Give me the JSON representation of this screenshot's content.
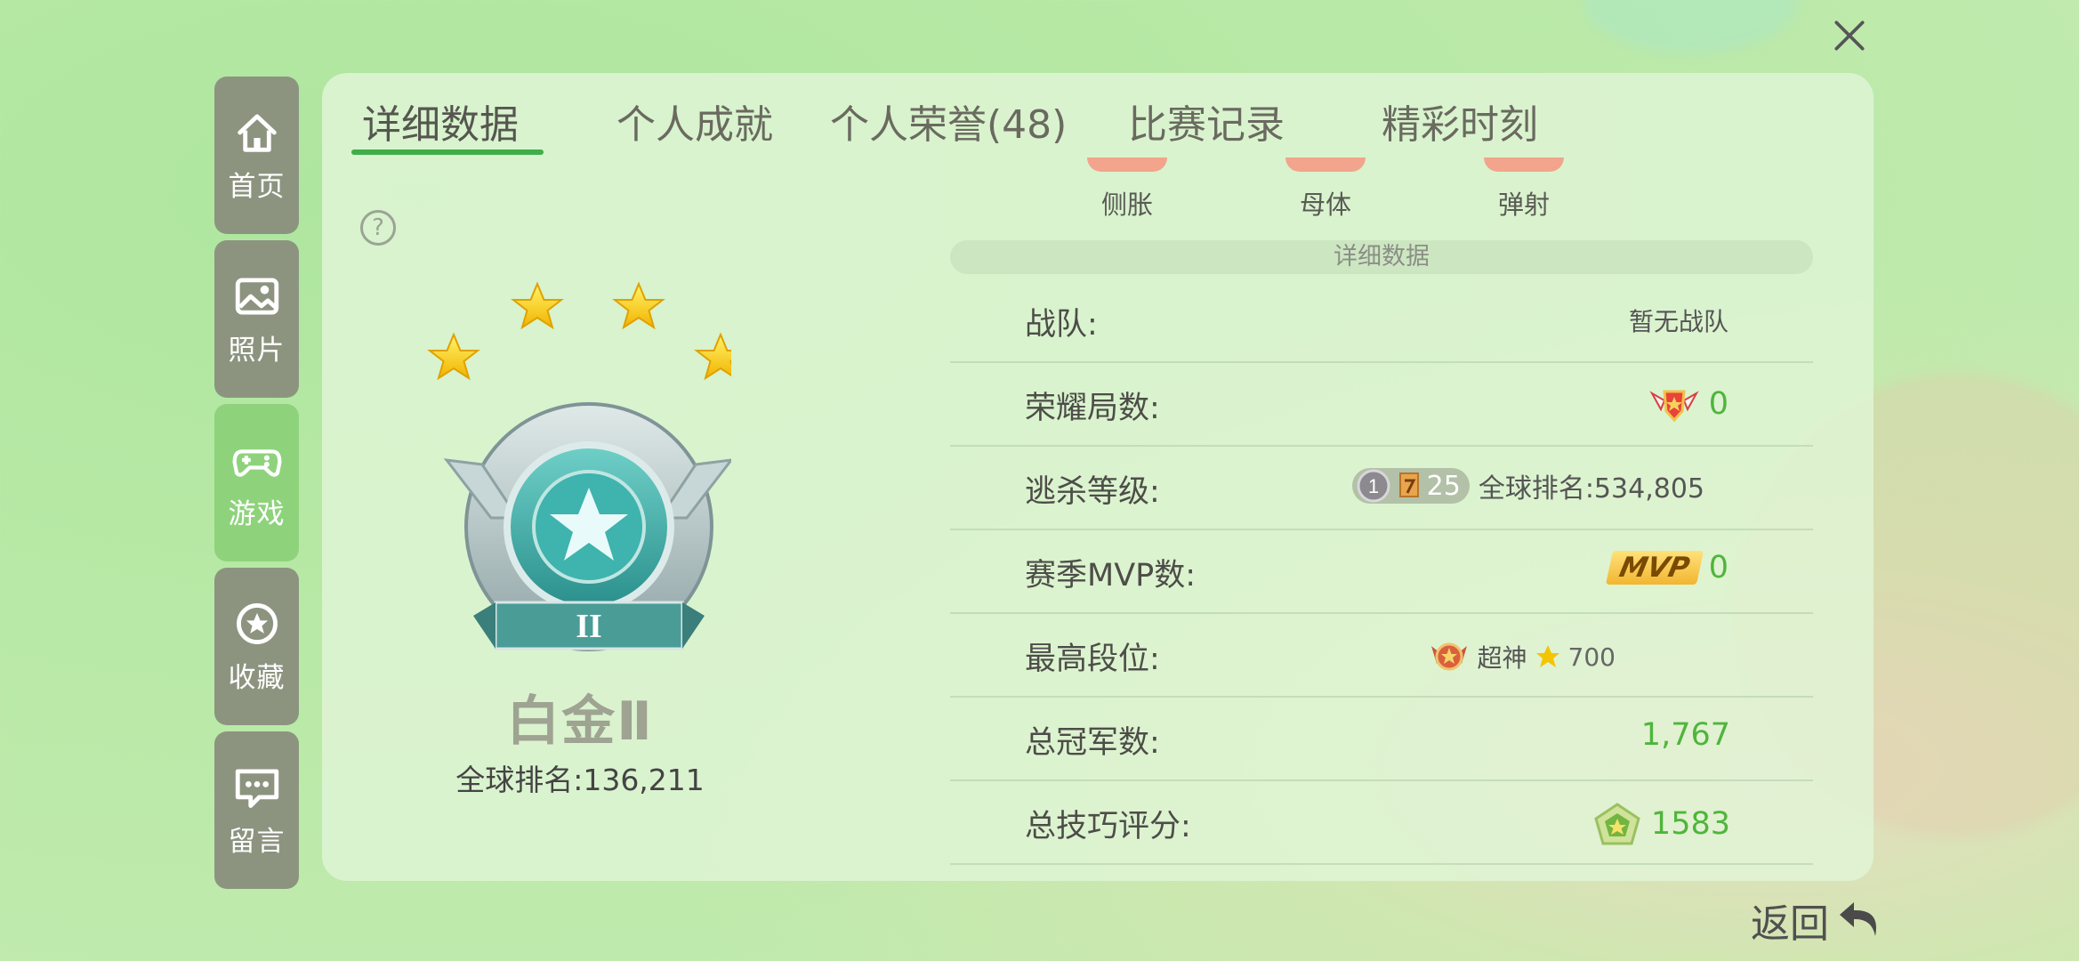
{
  "colors": {
    "accent_green": "#3fae49",
    "value_green": "#4fb53c",
    "sidebar_bg": "#8c9480",
    "sidebar_active": "#8ed37c"
  },
  "sidebar": {
    "items": [
      {
        "label": "首页",
        "icon": "home-icon"
      },
      {
        "label": "照片",
        "icon": "photo-icon"
      },
      {
        "label": "游戏",
        "icon": "gamepad-icon",
        "active": true
      },
      {
        "label": "收藏",
        "icon": "star-badge-icon"
      },
      {
        "label": "留言",
        "icon": "message-icon"
      }
    ]
  },
  "tabs": [
    {
      "label": "详细数据",
      "active": true
    },
    {
      "label": "个人成就"
    },
    {
      "label": "个人荣誉(48)"
    },
    {
      "label": "比赛记录"
    },
    {
      "label": "精彩时刻"
    }
  ],
  "rank": {
    "name": "白金Ⅱ",
    "emblem_numeral": "II",
    "global_rank": "全球排名:136,211",
    "stars": 4
  },
  "categories": [
    "侧胀",
    "母体",
    "弹射"
  ],
  "section_title": "详细数据",
  "stats": {
    "team": {
      "label": "战队:",
      "value": "暂无战队"
    },
    "glory": {
      "label": "荣耀局数:",
      "value": "0"
    },
    "escape_level": {
      "label": "逃杀等级:",
      "level_badge": "1",
      "level_value": "25",
      "global_rank": "全球排名:534,805"
    },
    "mvp": {
      "label": "赛季MVP数:",
      "badge": "MVP",
      "value": "0"
    },
    "highest_tier": {
      "label": "最高段位:",
      "tier": "超神",
      "stars": "700"
    },
    "champions": {
      "label": "总冠军数:",
      "value": "1,767"
    },
    "skill_score": {
      "label": "总技巧评分:",
      "value": "1583"
    }
  },
  "back_label": "返回"
}
